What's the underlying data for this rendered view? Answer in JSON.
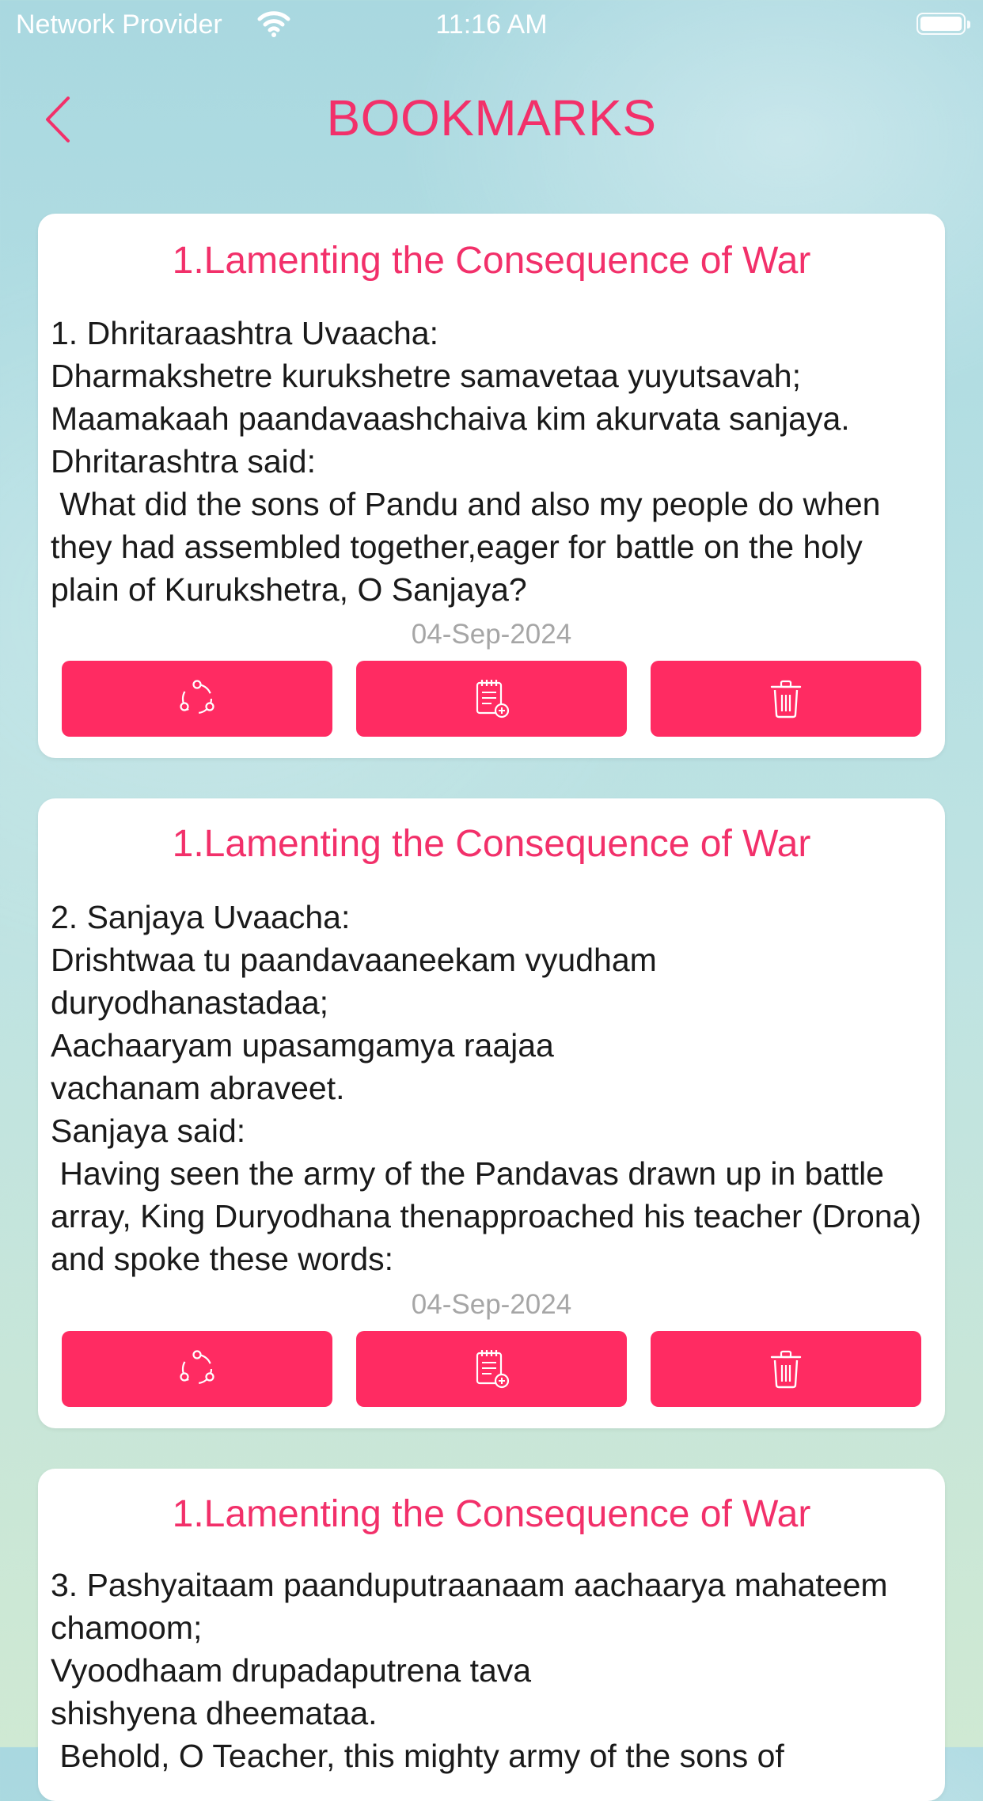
{
  "status_bar": {
    "provider": "Network Provider",
    "time": "11:16 AM"
  },
  "header": {
    "title": "BOOKMARKS",
    "back_icon": "chevron-left-icon"
  },
  "colors": {
    "accent": "#ff2b62",
    "title_text": "#f2306a",
    "date_text": "#a6a6a6"
  },
  "bookmarks": [
    {
      "chapter": "1.Lamenting the Consequence of War",
      "text": "1. Dhritaraashtra Uvaacha:\nDharmakshetre kurukshetre samavetaa yuyutsavah;\nMaamakaah paandavaashchaiva kim akurvata sanjaya.\nDhritarashtra said:\n What did the sons of Pandu and also my people do when they had assembled together,eager for battle on the holy plain of Kurukshetra, O Sanjaya?",
      "date": "04-Sep-2024"
    },
    {
      "chapter": "1.Lamenting the Consequence of War",
      "text": "2. Sanjaya Uvaacha:\nDrishtwaa tu paandavaaneekam vyudham duryodhanastadaa;\nAachaaryam upasamgamya raajaa\nvachanam abraveet.\nSanjaya said:\n Having seen the army of the Pandavas drawn up in battle array, King Duryodhana thenapproached his teacher (Drona) and spoke these words:",
      "date": "04-Sep-2024"
    },
    {
      "chapter": "1.Lamenting the Consequence of War",
      "text": "3. Pashyaitaam paanduputraanaam aachaarya mahateem chamoom;\nVyoodhaam drupadaputrena tava\nshishyena dheemataa.\n Behold, O Teacher, this mighty army of the sons of",
      "date": ""
    }
  ],
  "actions": {
    "share_icon": "share-icon",
    "note_icon": "add-note-icon",
    "delete_icon": "trash-icon"
  }
}
